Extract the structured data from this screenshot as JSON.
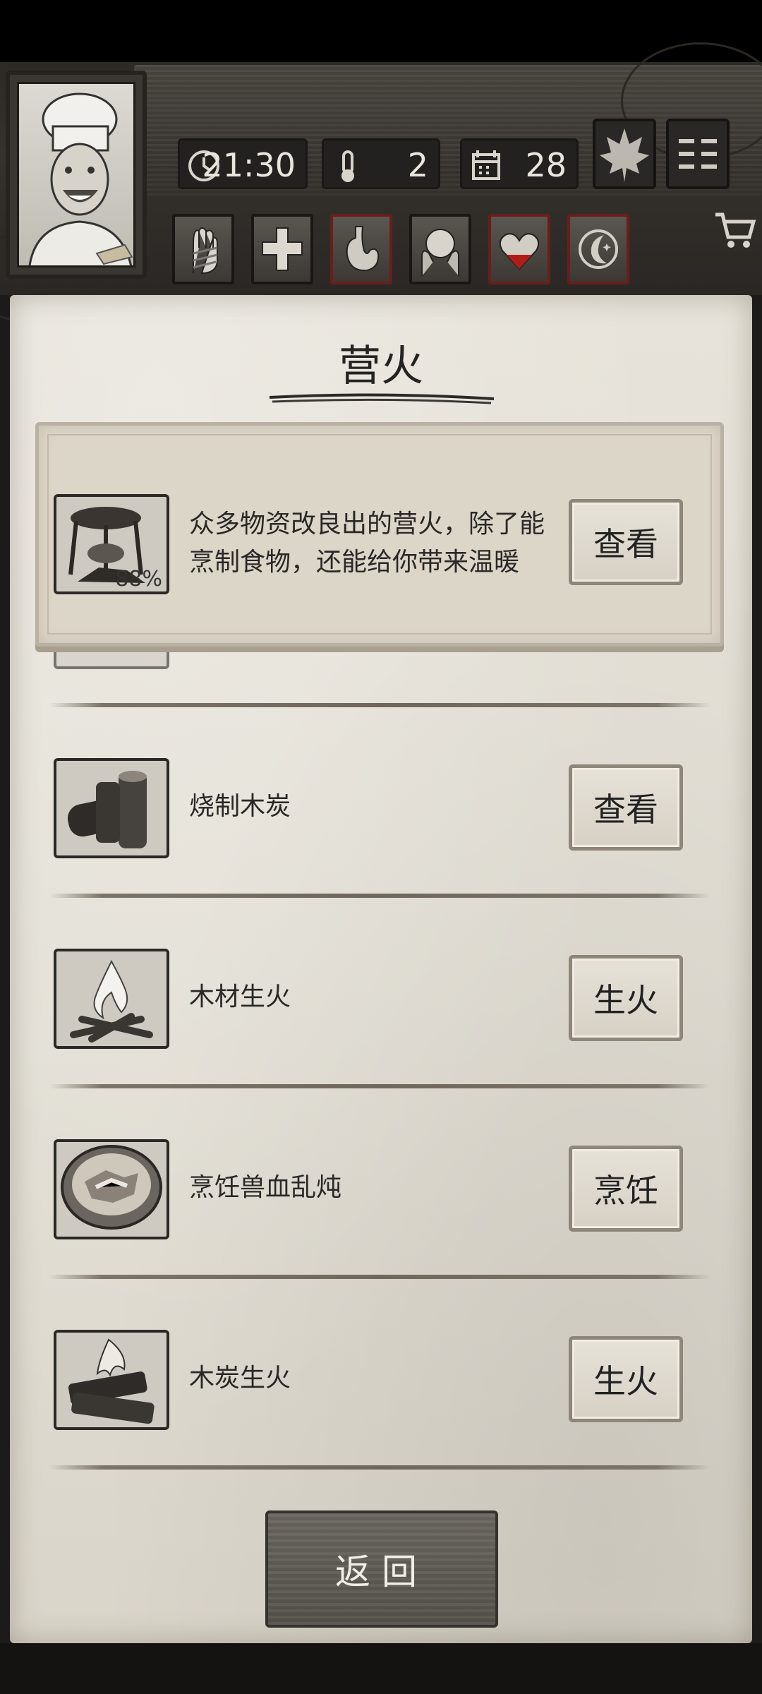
{
  "hud": {
    "time": "21:30",
    "temperature": "2",
    "day": "28"
  },
  "panel": {
    "title": "营火",
    "highlight": {
      "description_line1": "众多物资改良出的营火，除了能",
      "description_line2": "烹制食物，还能给你带来温暖",
      "progress_label": "88%",
      "button": "查看"
    },
    "rows": [
      {
        "label": "烧制木炭",
        "button": "查看"
      },
      {
        "label": "木材生火",
        "button": "生火"
      },
      {
        "label": "烹饪兽血乱炖",
        "button": "烹饪"
      },
      {
        "label": "木炭生火",
        "button": "生火"
      }
    ]
  },
  "footer": {
    "back_label": "返回"
  }
}
